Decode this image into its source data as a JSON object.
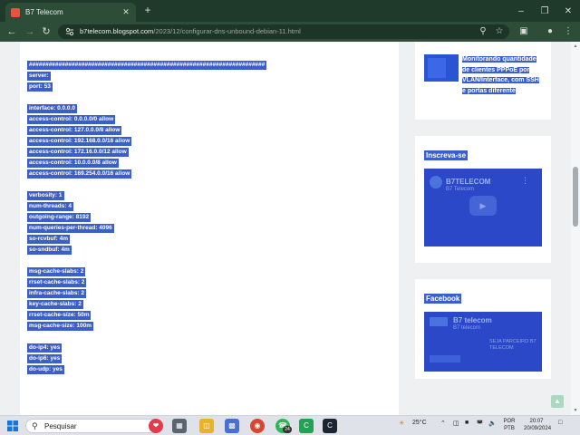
{
  "browser": {
    "tab_title": "B7 Telecom",
    "tab_close": "✕",
    "new_tab": "+",
    "url_host": "b7telecom.blogspot.com",
    "url_path": "/2023/12/configurar-dns-unbound-debian-11.html",
    "window_controls": {
      "minimize": "–",
      "restore": "❐",
      "close": "✕"
    }
  },
  "post": {
    "code_lines": [
      "########################################################################",
      "server:",
      "port: 53",
      "",
      "interface: 0.0.0.0",
      "access-control: 0.0.0.0/0 allow",
      "access-control: 127.0.0.0/8 allow",
      "access-control: 192.168.0.0/16 allow",
      "access-control: 172.16.0.0/12 allow",
      "access-control: 10.0.0.0/8 allow",
      "access-control: 169.254.0.0/16 allow",
      "",
      "verbosity: 1",
      "num-threads: 4",
      "outgoing-range: 8192",
      "num-queries-per-thread: 4096",
      "so-rcvbuf: 4m",
      "so-sndbuf: 4m",
      "",
      "msg-cache-slabs: 2",
      "rrset-cache-slabs: 2",
      "infra-cache-slabs: 2",
      "key-cache-slabs: 2",
      "rrset-cache-size: 50m",
      "msg-cache-size: 100m",
      "",
      "do-ip4: yes",
      "do-ip6: yes",
      "do-udp: yes"
    ]
  },
  "sidebar": {
    "popular_post_title": "Monitorando quantidade de clientes PPPoE por VLAN/Interface, com SSH e portas diferente",
    "subscribe_title": "Inscreva-se",
    "youtube_channel": "B7TELECOM",
    "youtube_sub": "B7 Telecom",
    "facebook_title": "Facebook",
    "facebook_page": "B7 telecom",
    "facebook_sub": "B7 telecom",
    "facebook_tag": "SEJA PARCEIRO B7 TELECOM"
  },
  "taskbar": {
    "search_placeholder": "Pesquisar",
    "temperature": "25°C",
    "lang_line1": "POR",
    "lang_line2": "PTB",
    "time": "20:07",
    "date": "20/09/2024",
    "notification_count": "24"
  },
  "colors": {
    "selection": "#3a5fcd",
    "chrome_dark": "#1f3a2a",
    "chrome_mid": "#2d4d38"
  }
}
